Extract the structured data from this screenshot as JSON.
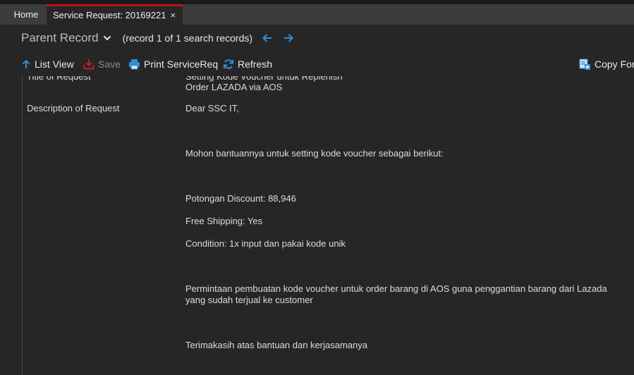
{
  "tabs": {
    "home": "Home",
    "active": "Service Request: 20169221",
    "close_glyph": "×"
  },
  "header": {
    "title": "Parent Record",
    "record_info": "(record 1 of 1 search records)"
  },
  "toolbar": {
    "list_view": "List View",
    "save": "Save",
    "print": "Print ServiceReq",
    "refresh": "Refresh",
    "copy": "Copy For"
  },
  "fields": {
    "title_label": "Title of Request",
    "title_line1": "Setting Kode Voucher untuk Replenish",
    "title_line2": "Order LAZADA via AOS",
    "description_label": "Description of Request",
    "description_lines": [
      "Dear SSC IT,",
      "Mohon bantuannya untuk setting kode voucher sebagai berikut:",
      "Potongan Discount: 88,946",
      "Free Shipping: Yes",
      "Condition: 1x input dan pakai kode unik",
      "Permintaan pembuatan kode voucher untuk order barang di AOS guna penggantian barang dari Lazada",
      "yang sudah terjual ke customer",
      "Terimakasih atas bantuan dan kerjasamanya"
    ]
  },
  "colors": {
    "accent_blue": "#2f8fd8",
    "tab_active_border": "#c0101a",
    "save_icon": "#b5261e"
  }
}
